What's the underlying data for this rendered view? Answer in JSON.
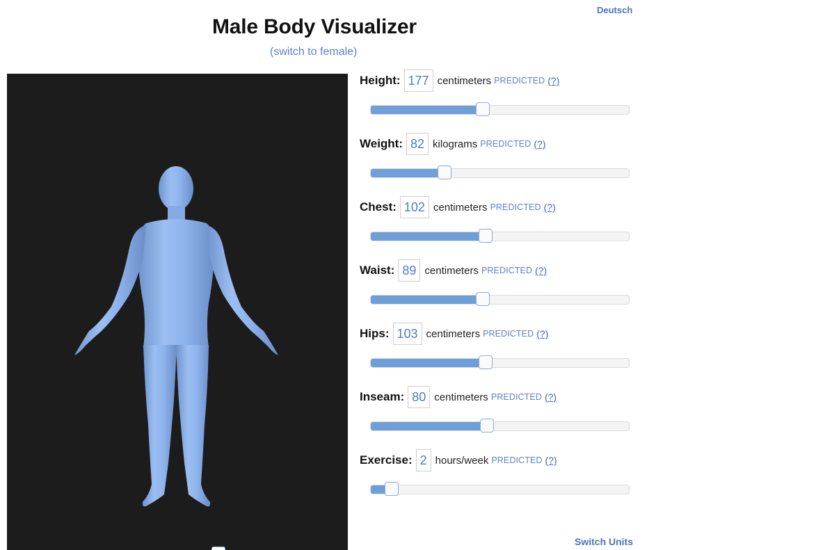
{
  "header": {
    "language_link": "Deutsch",
    "title": "Male Body Visualizer",
    "switch_gender": "(switch to female)"
  },
  "model": {
    "body_color": "#8fb4ee",
    "background_color": "#1c1c1c"
  },
  "fields": [
    {
      "label": "Height:",
      "value": "177",
      "unit": "centimeters",
      "predicted": "PREDICTED",
      "help": "(?)",
      "slider_fraction": 0.44
    },
    {
      "label": "Weight:",
      "value": "82",
      "unit": "kilograms",
      "predicted": "PREDICTED",
      "help": "(?)",
      "slider_fraction": 0.29
    },
    {
      "label": "Chest:",
      "value": "102",
      "unit": "centimeters",
      "predicted": "PREDICTED",
      "help": "(?)",
      "slider_fraction": 0.45
    },
    {
      "label": "Waist:",
      "value": "89",
      "unit": "centimeters",
      "predicted": "PREDICTED",
      "help": "(?)",
      "slider_fraction": 0.44
    },
    {
      "label": "Hips:",
      "value": "103",
      "unit": "centimeters",
      "predicted": "PREDICTED",
      "help": "(?)",
      "slider_fraction": 0.45
    },
    {
      "label": "Inseam:",
      "value": "80",
      "unit": "centimeters",
      "predicted": "PREDICTED",
      "help": "(?)",
      "slider_fraction": 0.455
    },
    {
      "label": "Exercise:",
      "value": "2",
      "unit": "hours/week",
      "predicted": "PREDICTED",
      "help": "(?)",
      "slider_fraction": 0.085
    }
  ],
  "footer": {
    "switch_units": "Switch Units"
  },
  "colors": {
    "accent": "#5b82c9",
    "slider_fill": "#6f9fd8"
  }
}
